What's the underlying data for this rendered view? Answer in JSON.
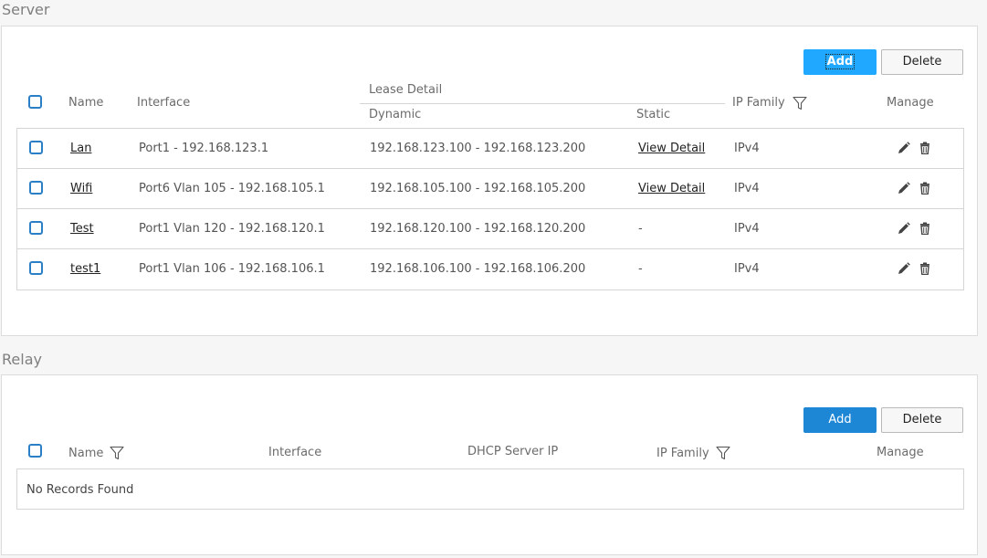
{
  "server": {
    "title": "Server",
    "add_label": "Add",
    "delete_label": "Delete",
    "headers": {
      "name": "Name",
      "interface": "Interface",
      "lease_detail": "Lease Detail",
      "dynamic": "Dynamic",
      "static": "Static",
      "ip_family": "IP Family",
      "manage": "Manage"
    },
    "rows": [
      {
        "name": "Lan",
        "interface": "Port1 - 192.168.123.1",
        "dynamic": "192.168.123.100 - 192.168.123.200",
        "static": "View Detail",
        "ip_family": "IPv4"
      },
      {
        "name": "Wifi",
        "interface": "Port6 Vlan 105 - 192.168.105.1",
        "dynamic": "192.168.105.100 - 192.168.105.200",
        "static": "View Detail",
        "ip_family": "IPv4"
      },
      {
        "name": "Test",
        "interface": "Port1 Vlan 120 - 192.168.120.1",
        "dynamic": "192.168.120.100 - 192.168.120.200",
        "static": "-",
        "ip_family": "IPv4"
      },
      {
        "name": "test1",
        "interface": "Port1 Vlan 106 - 192.168.106.1",
        "dynamic": "192.168.106.100 - 192.168.106.200",
        "static": "-",
        "ip_family": "IPv4"
      }
    ]
  },
  "relay": {
    "title": "Relay",
    "add_label": "Add",
    "delete_label": "Delete",
    "headers": {
      "name": "Name",
      "interface": "Interface",
      "dhcp_server_ip": "DHCP Server IP",
      "ip_family": "IP Family",
      "manage": "Manage"
    },
    "empty_text": "No Records Found"
  },
  "colors": {
    "primary": "#1d87d6",
    "primary_focused": "#20a7ff",
    "checkbox": "#2a7fc7"
  },
  "icons": [
    "filter-icon",
    "pencil-edit-icon",
    "trash-delete-icon",
    "checkbox"
  ]
}
